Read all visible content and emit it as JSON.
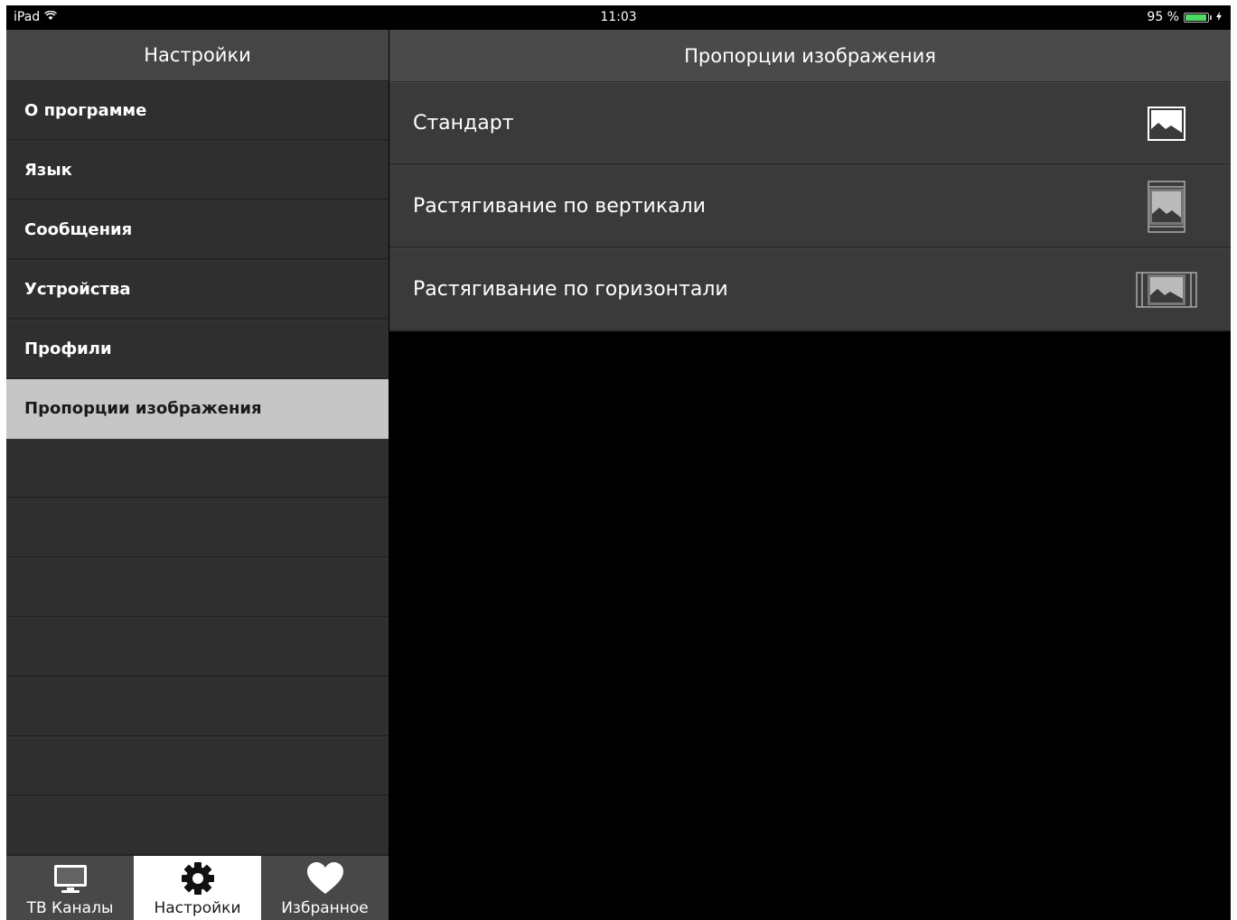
{
  "status_bar": {
    "device": "iPad",
    "time": "11:03",
    "battery": "95 %",
    "battery_level": 0.95
  },
  "sidebar": {
    "title": "Настройки",
    "items": [
      {
        "label": "О программе"
      },
      {
        "label": "Язык"
      },
      {
        "label": "Сообщения"
      },
      {
        "label": "Устройства"
      },
      {
        "label": "Профили"
      },
      {
        "label": "Пропорции изображения",
        "selected": true
      }
    ]
  },
  "tabbar": {
    "tabs": [
      {
        "label": "ТВ Каналы",
        "icon": "tv-icon"
      },
      {
        "label": "Настройки",
        "icon": "gear-icon",
        "active": true
      },
      {
        "label": "Избранное",
        "icon": "heart-icon"
      }
    ]
  },
  "detail": {
    "title": "Пропорции изображения",
    "options": [
      {
        "label": "Стандарт",
        "icon": "aspect-standard-icon"
      },
      {
        "label": "Растягивание по вертикали",
        "icon": "aspect-vertical-stretch-icon"
      },
      {
        "label": "Растягивание по горизонтали",
        "icon": "aspect-horizontal-stretch-icon"
      }
    ]
  },
  "colors": {
    "battery_green": "#4cd964",
    "selected_row": "#c6c6c6",
    "panel_bg": "#2e2e2e"
  }
}
